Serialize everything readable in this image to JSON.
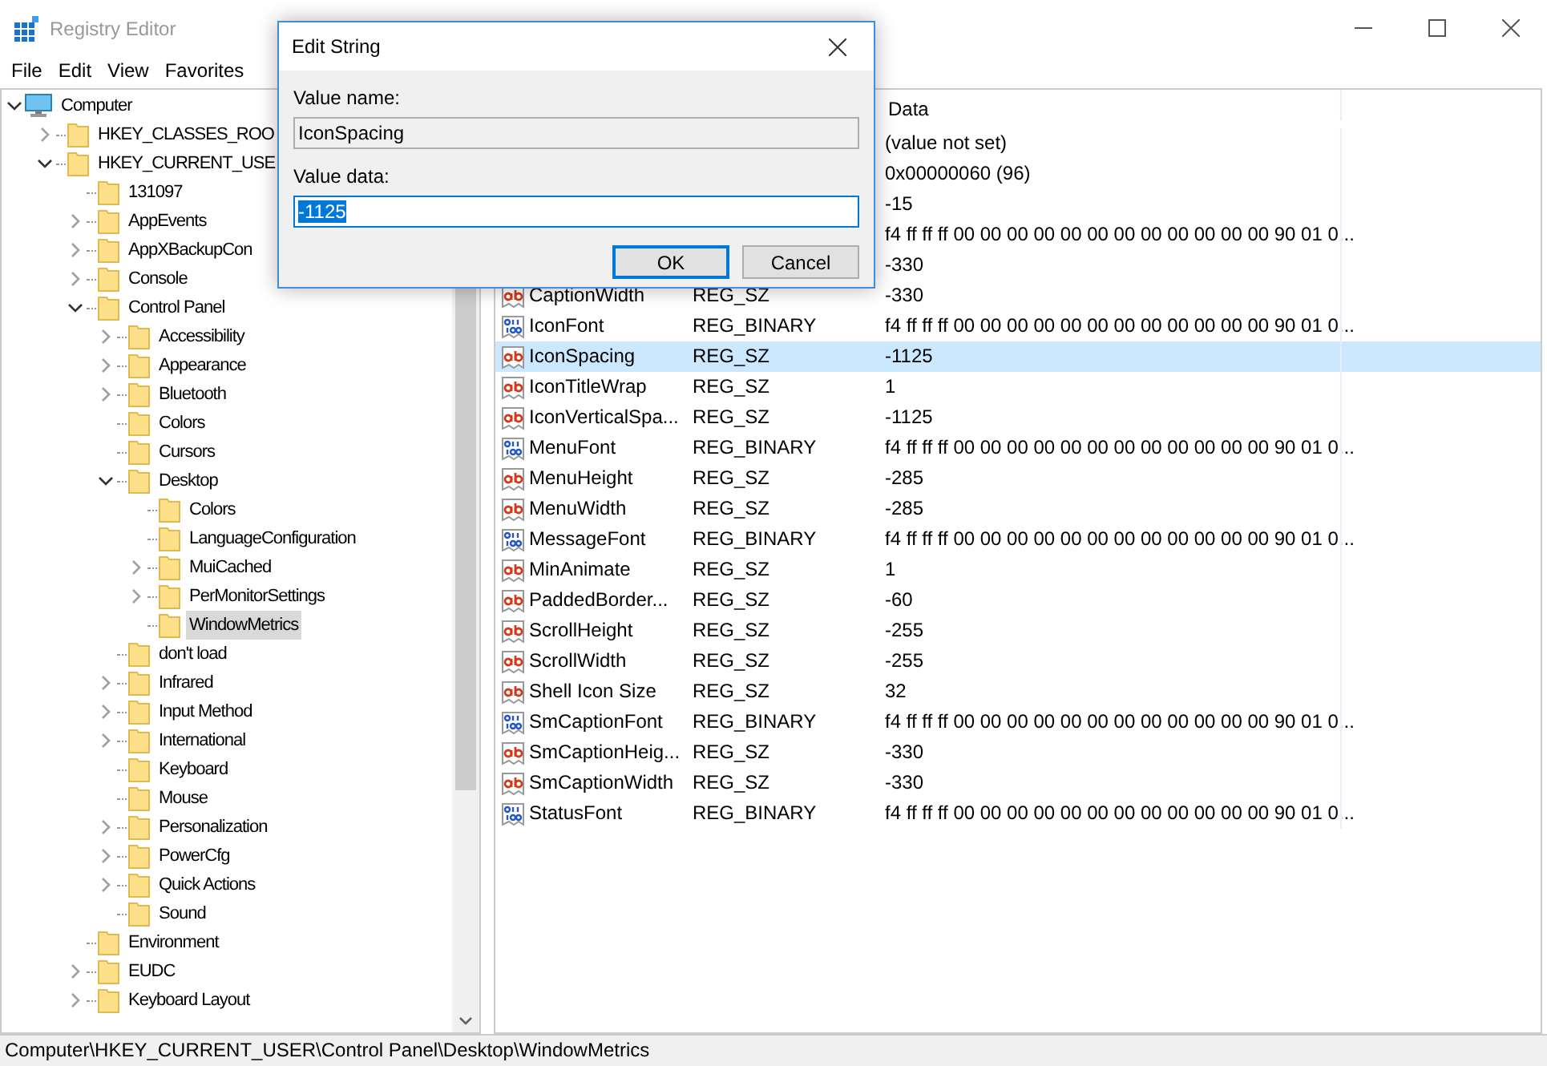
{
  "window": {
    "title": "Registry Editor"
  },
  "menu": [
    {
      "label": "File"
    },
    {
      "label": "Edit"
    },
    {
      "label": "View"
    },
    {
      "label": "Favorites"
    }
  ],
  "tree": [
    {
      "label": "Computer",
      "kind": "computer",
      "expandable": true,
      "expanded": true,
      "selected": false,
      "children": [
        {
          "label": "HKEY_CLASSES_ROO",
          "kind": "folder",
          "expandable": true,
          "expanded": false,
          "selected": false
        },
        {
          "label": "HKEY_CURRENT_USE",
          "kind": "folder",
          "expandable": true,
          "expanded": true,
          "selected": false,
          "children": [
            {
              "label": "131097",
              "kind": "folder",
              "expandable": false,
              "expanded": false,
              "selected": false
            },
            {
              "label": "AppEvents",
              "kind": "folder",
              "expandable": true,
              "expanded": false,
              "selected": false
            },
            {
              "label": "AppXBackupCon",
              "kind": "folder",
              "expandable": true,
              "expanded": false,
              "selected": false
            },
            {
              "label": "Console",
              "kind": "folder",
              "expandable": true,
              "expanded": false,
              "selected": false
            },
            {
              "label": "Control Panel",
              "kind": "folder",
              "expandable": true,
              "expanded": true,
              "selected": false,
              "children": [
                {
                  "label": "Accessibility",
                  "kind": "folder",
                  "expandable": true,
                  "expanded": false,
                  "selected": false
                },
                {
                  "label": "Appearance",
                  "kind": "folder",
                  "expandable": true,
                  "expanded": false,
                  "selected": false
                },
                {
                  "label": "Bluetooth",
                  "kind": "folder",
                  "expandable": true,
                  "expanded": false,
                  "selected": false
                },
                {
                  "label": "Colors",
                  "kind": "folder",
                  "expandable": false,
                  "expanded": false,
                  "selected": false
                },
                {
                  "label": "Cursors",
                  "kind": "folder",
                  "expandable": false,
                  "expanded": false,
                  "selected": false
                },
                {
                  "label": "Desktop",
                  "kind": "folder",
                  "expandable": true,
                  "expanded": true,
                  "selected": false,
                  "children": [
                    {
                      "label": "Colors",
                      "kind": "folder",
                      "expandable": false,
                      "expanded": false,
                      "selected": false
                    },
                    {
                      "label": "LanguageConfiguration",
                      "kind": "folder",
                      "expandable": false,
                      "expanded": false,
                      "selected": false
                    },
                    {
                      "label": "MuiCached",
                      "kind": "folder",
                      "expandable": true,
                      "expanded": false,
                      "selected": false
                    },
                    {
                      "label": "PerMonitorSettings",
                      "kind": "folder",
                      "expandable": true,
                      "expanded": false,
                      "selected": false
                    },
                    {
                      "label": "WindowMetrics",
                      "kind": "folder",
                      "expandable": false,
                      "expanded": false,
                      "selected": true
                    }
                  ]
                },
                {
                  "label": "don't load",
                  "kind": "folder",
                  "expandable": false,
                  "expanded": false,
                  "selected": false
                },
                {
                  "label": "Infrared",
                  "kind": "folder",
                  "expandable": true,
                  "expanded": false,
                  "selected": false
                },
                {
                  "label": "Input Method",
                  "kind": "folder",
                  "expandable": true,
                  "expanded": false,
                  "selected": false
                },
                {
                  "label": "International",
                  "kind": "folder",
                  "expandable": true,
                  "expanded": false,
                  "selected": false
                },
                {
                  "label": "Keyboard",
                  "kind": "folder",
                  "expandable": false,
                  "expanded": false,
                  "selected": false
                },
                {
                  "label": "Mouse",
                  "kind": "folder",
                  "expandable": false,
                  "expanded": false,
                  "selected": false
                },
                {
                  "label": "Personalization",
                  "kind": "folder",
                  "expandable": true,
                  "expanded": false,
                  "selected": false
                },
                {
                  "label": "PowerCfg",
                  "kind": "folder",
                  "expandable": true,
                  "expanded": false,
                  "selected": false
                },
                {
                  "label": "Quick Actions",
                  "kind": "folder",
                  "expandable": true,
                  "expanded": false,
                  "selected": false
                },
                {
                  "label": "Sound",
                  "kind": "folder",
                  "expandable": false,
                  "expanded": false,
                  "selected": false
                }
              ]
            },
            {
              "label": "Environment",
              "kind": "folder",
              "expandable": false,
              "expanded": false,
              "selected": false
            },
            {
              "label": "EUDC",
              "kind": "folder",
              "expandable": true,
              "expanded": false,
              "selected": false
            },
            {
              "label": "Keyboard Layout",
              "kind": "folder",
              "expandable": true,
              "expanded": false,
              "selected": false
            }
          ]
        }
      ]
    }
  ],
  "values": {
    "columns": [
      {
        "label": "Data"
      }
    ],
    "rows": [
      {
        "data": "(value not set)",
        "selected": false
      },
      {
        "data": "0x00000060 (96)",
        "selected": false
      },
      {
        "data": "-15",
        "selected": false
      },
      {
        "data": "f4 ff ff ff 00 00 00 00 00 00 00 00 00 00 00 00 90 01 0...",
        "selected": false
      },
      {
        "data": "-330",
        "selected": false
      },
      {
        "name": "CaptionWidth",
        "type": "REG_SZ",
        "kind": "string",
        "data": "-330",
        "selected": false
      },
      {
        "name": "IconFont",
        "type": "REG_BINARY",
        "kind": "binary",
        "data": "f4 ff ff ff 00 00 00 00 00 00 00 00 00 00 00 00 90 01 0...",
        "selected": false
      },
      {
        "name": "IconSpacing",
        "type": "REG_SZ",
        "kind": "string",
        "data": "-1125",
        "selected": true
      },
      {
        "name": "IconTitleWrap",
        "type": "REG_SZ",
        "kind": "string",
        "data": "1",
        "selected": false
      },
      {
        "name": "IconVerticalSpa...",
        "type": "REG_SZ",
        "kind": "string",
        "data": "-1125",
        "selected": false
      },
      {
        "name": "MenuFont",
        "type": "REG_BINARY",
        "kind": "binary",
        "data": "f4 ff ff ff 00 00 00 00 00 00 00 00 00 00 00 00 90 01 0...",
        "selected": false
      },
      {
        "name": "MenuHeight",
        "type": "REG_SZ",
        "kind": "string",
        "data": "-285",
        "selected": false
      },
      {
        "name": "MenuWidth",
        "type": "REG_SZ",
        "kind": "string",
        "data": "-285",
        "selected": false
      },
      {
        "name": "MessageFont",
        "type": "REG_BINARY",
        "kind": "binary",
        "data": "f4 ff ff ff 00 00 00 00 00 00 00 00 00 00 00 00 90 01 0...",
        "selected": false
      },
      {
        "name": "MinAnimate",
        "type": "REG_SZ",
        "kind": "string",
        "data": "1",
        "selected": false
      },
      {
        "name": "PaddedBorder...",
        "type": "REG_SZ",
        "kind": "string",
        "data": "-60",
        "selected": false
      },
      {
        "name": "ScrollHeight",
        "type": "REG_SZ",
        "kind": "string",
        "data": "-255",
        "selected": false
      },
      {
        "name": "ScrollWidth",
        "type": "REG_SZ",
        "kind": "string",
        "data": "-255",
        "selected": false
      },
      {
        "name": "Shell Icon Size",
        "type": "REG_SZ",
        "kind": "string",
        "data": "32",
        "selected": false
      },
      {
        "name": "SmCaptionFont",
        "type": "REG_BINARY",
        "kind": "binary",
        "data": "f4 ff ff ff 00 00 00 00 00 00 00 00 00 00 00 00 90 01 0...",
        "selected": false
      },
      {
        "name": "SmCaptionHeig...",
        "type": "REG_SZ",
        "kind": "string",
        "data": "-330",
        "selected": false
      },
      {
        "name": "SmCaptionWidth",
        "type": "REG_SZ",
        "kind": "string",
        "data": "-330",
        "selected": false
      },
      {
        "name": "StatusFont",
        "type": "REG_BINARY",
        "kind": "binary",
        "data": "f4 ff ff ff 00 00 00 00 00 00 00 00 00 00 00 00 90 01 0...",
        "selected": false
      }
    ]
  },
  "status_bar": {
    "path": "Computer\\HKEY_CURRENT_USER\\Control Panel\\Desktop\\WindowMetrics"
  },
  "dialog": {
    "title": "Edit String",
    "name_label": "Value name:",
    "name_value": "IconSpacing",
    "data_label": "Value data:",
    "data_value": "-1125",
    "data_text_selected": true,
    "buttons": [
      {
        "label": "OK",
        "default": true
      },
      {
        "label": "Cancel",
        "default": false
      }
    ]
  }
}
